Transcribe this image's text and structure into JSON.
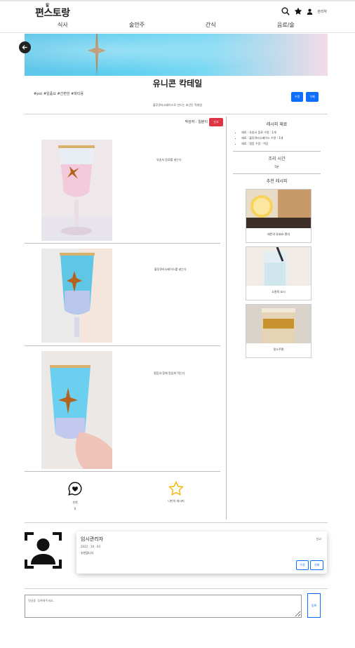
{
  "header": {
    "logo": "편스토랑",
    "nav": [
      "식사",
      "술안주",
      "간식",
      "음료/술"
    ],
    "user_name": "관리자"
  },
  "recipe": {
    "title": "유니콘 칵테일",
    "tags": "#pot #일품요 #간편한 #파티용",
    "edit_label": "수정",
    "delete_label": "삭제",
    "description": "블루큐라소베이스로 만드는 초간단 칵테일",
    "author": "작성자 : 일분이",
    "report_label": "신고"
  },
  "steps": [
    {
      "text": "유송서 음료를 넣는다"
    },
    {
      "text": "블루큐라소베이스를 넣는다"
    },
    {
      "text": "얼음과 함께 맛있게 먹는다"
    }
  ],
  "sidebar": {
    "ingredients_title": "레시피 재료",
    "ingredients": [
      "재료 : 유송서 음료  수량 : 1개",
      "재료 : 블루큐라소베이스  수량 : 1개",
      "재료 : 얼음  수량 : 적당"
    ],
    "time_title": "조리 시간",
    "time_value": "5분",
    "recommend_title": "추천 레시피",
    "recommend": [
      {
        "caption": "레몬의 유효요 편의"
      },
      {
        "caption": "소원의 요시"
      },
      {
        "caption": "맛소주짱"
      }
    ]
  },
  "actions": {
    "like_label": "추천",
    "like_count": "0",
    "favorite_label": "나만의 레시피"
  },
  "comment": {
    "author": "임시관리자",
    "date": "2022 · 10 · 03",
    "text": "추천합니다",
    "report_label": "신고",
    "edit_label": "수정",
    "delete_label": "삭제"
  },
  "comment_form": {
    "placeholder": "댓글을 등록해주세요.",
    "submit_label": "등록"
  },
  "colors": {
    "primary": "#0d6efd",
    "danger": "#dc3545"
  }
}
